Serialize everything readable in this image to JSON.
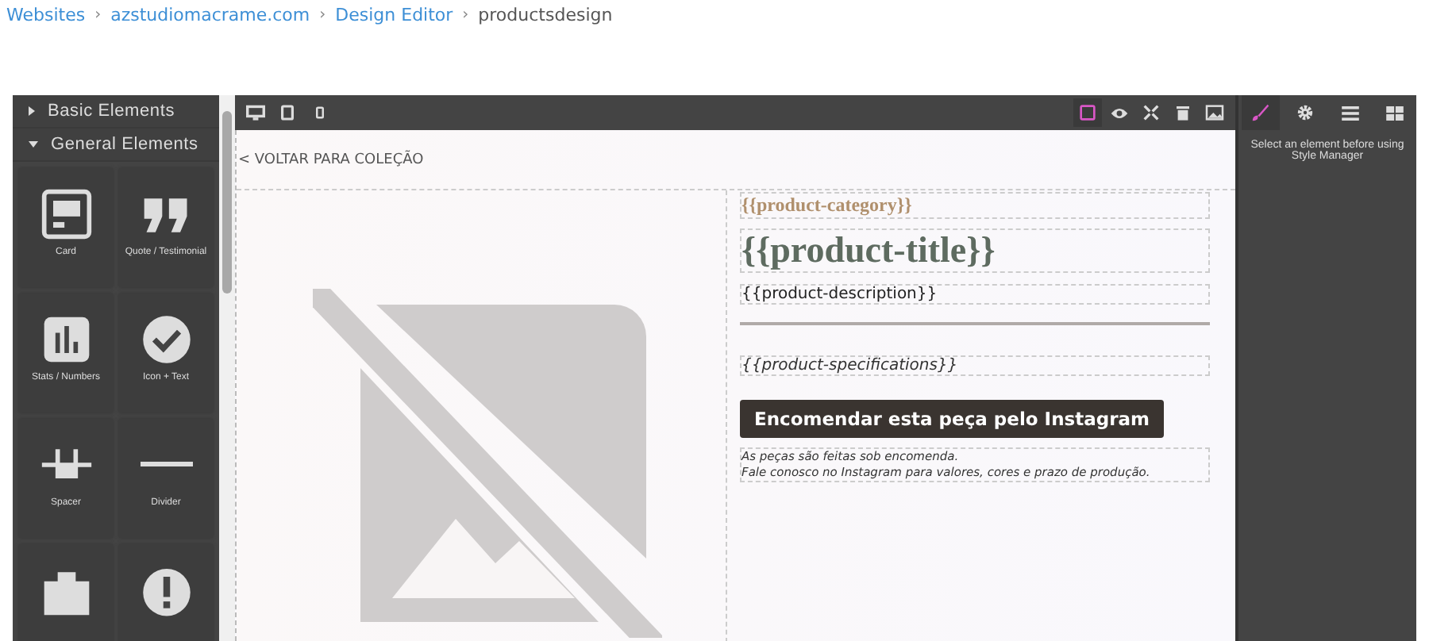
{
  "breadcrumb": [
    {
      "label": "Websites",
      "link": true,
      "separator": "›"
    },
    {
      "label": "azstudiomacrame.com",
      "link": true,
      "separator": "›"
    },
    {
      "label": "Design Editor",
      "link": true,
      "separator": "›"
    },
    {
      "label": "productsdesign",
      "link": false
    }
  ],
  "devices": [
    {
      "kind": "desktop"
    },
    {
      "kind": "tablet"
    },
    {
      "kind": "mobile"
    }
  ],
  "canvas_tools": [
    {
      "kind": "outline",
      "selected": true
    },
    {
      "kind": "preview",
      "selected": false
    },
    {
      "kind": "fullscreen",
      "selected": false
    },
    {
      "kind": "trash",
      "selected": false
    },
    {
      "kind": "image",
      "selected": false
    }
  ],
  "panel_tabs": [
    {
      "kind": "brush",
      "selected": true
    },
    {
      "kind": "gear",
      "selected": false
    },
    {
      "kind": "layers",
      "selected": false
    },
    {
      "kind": "blocks",
      "selected": false
    }
  ],
  "categories": [
    {
      "title": "Basic Elements",
      "expanded": false
    },
    {
      "title": "General Elements",
      "expanded": true,
      "blocks": [
        {
          "kind": "card",
          "label": "Card"
        },
        {
          "kind": "quote",
          "label": "Quote / Testimonial"
        },
        {
          "kind": "stats",
          "label": "Stats / Numbers"
        },
        {
          "kind": "check",
          "label": "Icon + Text"
        },
        {
          "kind": "spacer",
          "label": "Spacer"
        },
        {
          "kind": "divider",
          "label": "Divider"
        },
        {
          "kind": "bag"
        },
        {
          "kind": "alert"
        }
      ]
    }
  ],
  "canvas": {
    "back_link": "< VOLTAR PARA COLEÇÃO",
    "category": "{{product-category}}",
    "title": "{{product-title}}",
    "description": "{{product-description}}",
    "specifications": "{{product-specifications}}",
    "order_button": "Encomendar esta peça pelo Instagram",
    "note_lines": [
      "As peças são feitas sob encomenda.",
      "Fale conosco no Instagram para valores, cores e prazo de produção."
    ]
  },
  "style_manager": {
    "message": "Select an element before using Style Manager"
  }
}
